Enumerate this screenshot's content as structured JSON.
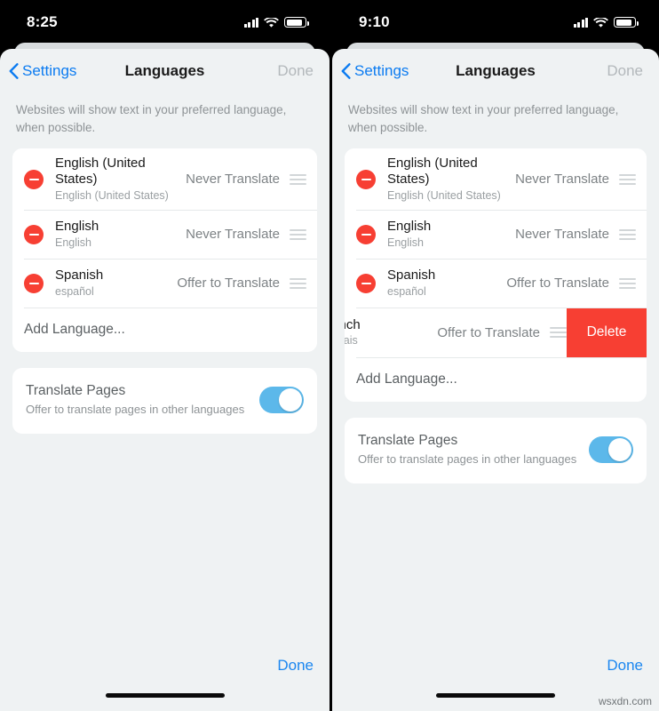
{
  "panels": [
    {
      "id": "left",
      "status": {
        "time": "8:25",
        "icons": [
          "cellular-signal-icon",
          "wifi-icon",
          "battery-icon"
        ]
      },
      "nav": {
        "back_label": "Settings",
        "title": "Languages",
        "done_label": "Done"
      },
      "description": "Websites will show text in your preferred language, when possible.",
      "languages": [
        {
          "primary": "English (United States)",
          "secondary": "English (United States)",
          "status": "Never Translate"
        },
        {
          "primary": "English",
          "secondary": "English",
          "status": "Never Translate"
        },
        {
          "primary": "Spanish",
          "secondary": "español",
          "status": "Offer to Translate"
        }
      ],
      "swiped_row": null,
      "add_language_label": "Add Language...",
      "translate_pages": {
        "title": "Translate Pages",
        "subtitle": "Offer to translate pages in other languages",
        "toggle_on": true
      },
      "bottom_done_label": "Done",
      "watermark": ""
    },
    {
      "id": "right",
      "status": {
        "time": "9:10",
        "icons": [
          "cellular-signal-icon",
          "wifi-icon",
          "battery-icon"
        ]
      },
      "nav": {
        "back_label": "Settings",
        "title": "Languages",
        "done_label": "Done"
      },
      "description": "Websites will show text in your preferred language, when possible.",
      "languages": [
        {
          "primary": "English (United States)",
          "secondary": "English (United States)",
          "status": "Never Translate"
        },
        {
          "primary": "English",
          "secondary": "English",
          "status": "Never Translate"
        },
        {
          "primary": "Spanish",
          "secondary": "español",
          "status": "Offer to Translate"
        }
      ],
      "swiped_row": {
        "primary": "French",
        "secondary": "français",
        "status": "Offer to Translate",
        "delete_label": "Delete"
      },
      "add_language_label": "Add Language...",
      "translate_pages": {
        "title": "Translate Pages",
        "subtitle": "Offer to translate pages in other languages",
        "toggle_on": true
      },
      "bottom_done_label": "Done",
      "watermark": "wsxdn.com"
    }
  ],
  "colors": {
    "accent_blue": "#0b7bf1",
    "destructive_red": "#f73f33",
    "toggle_on_blue": "#5cb8ea",
    "page_background": "#eff2f3",
    "card_background": "#ffffff"
  }
}
